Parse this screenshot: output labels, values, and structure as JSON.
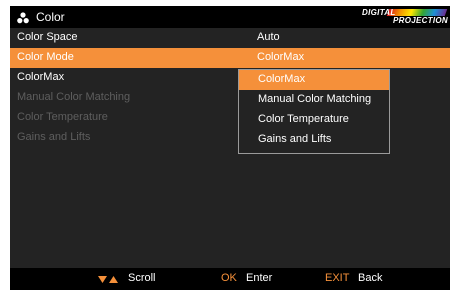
{
  "header": {
    "title": "Color",
    "icon": "color-dots-icon",
    "logo": {
      "line1": "DIGITAL",
      "line2": "PROJECTION"
    }
  },
  "menu": {
    "rows": [
      {
        "label": "Color Space",
        "value": "Auto",
        "state": "enabled"
      },
      {
        "label": "Color Mode",
        "value": "ColorMax",
        "state": "highlighted"
      },
      {
        "label": "ColorMax",
        "value": "",
        "state": "enabled"
      },
      {
        "label": "Manual Color Matching",
        "value": "",
        "state": "disabled"
      },
      {
        "label": "Color Temperature",
        "value": "",
        "state": "disabled"
      },
      {
        "label": "Gains and Lifts",
        "value": "",
        "state": "disabled"
      }
    ]
  },
  "dropdown": {
    "options": [
      "ColorMax",
      "Manual Color Matching",
      "Color Temperature",
      "Gains and Lifts"
    ],
    "selected": "ColorMax"
  },
  "footer": {
    "scroll_icon": "up-down-arrows-icon",
    "scroll_label": "Scroll",
    "ok_key": "OK",
    "ok_label": "Enter",
    "exit_key": "EXIT",
    "exit_label": "Back"
  },
  "colors": {
    "accent": "#f5903a",
    "background": "#232323",
    "bar": "#000000",
    "disabled": "#5e5e5e"
  }
}
